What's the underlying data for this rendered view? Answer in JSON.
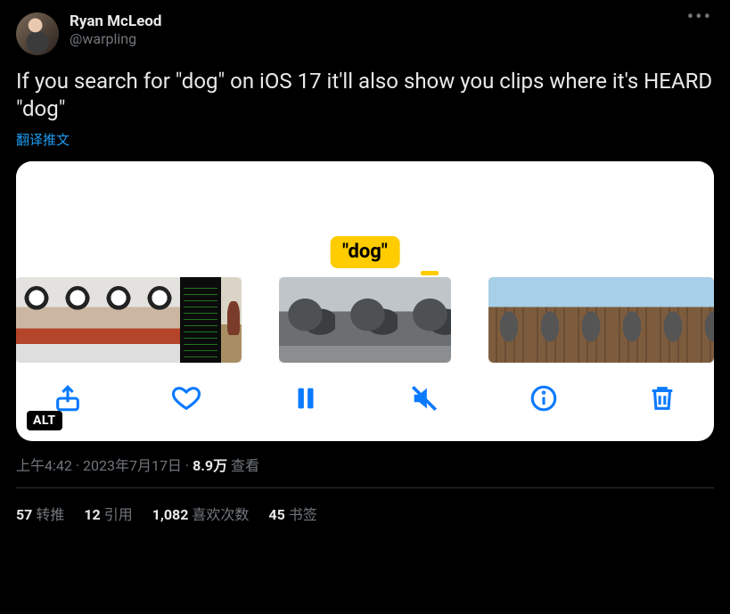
{
  "author": {
    "display_name": "Ryan McLeod",
    "handle": "@warpling"
  },
  "tweet_text": "If you search for \"dog\" on iOS 17 it'll also show you clips where it's HEARD \"dog\"",
  "translate_label": "翻译推文",
  "media": {
    "dog_label": "\"dog\"",
    "alt_badge": "ALT"
  },
  "meta": {
    "time": "上午4:42",
    "date": "2023年7月17日",
    "views_count": "8.9万",
    "views_label": "查看"
  },
  "stats": {
    "retweets_count": "57",
    "retweets_label": "转推",
    "quotes_count": "12",
    "quotes_label": "引用",
    "likes_count": "1,082",
    "likes_label": "喜欢次数",
    "bookmarks_count": "45",
    "bookmarks_label": "书签"
  }
}
